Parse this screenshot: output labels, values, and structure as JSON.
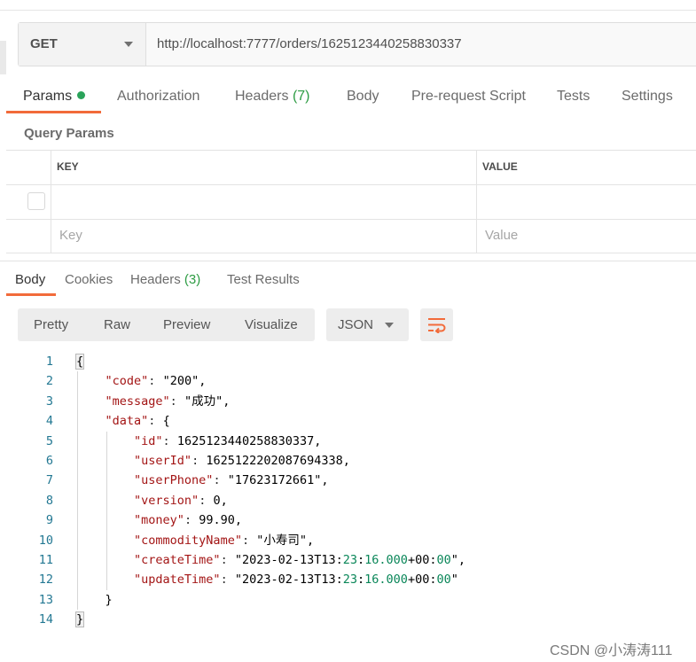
{
  "request": {
    "method": "GET",
    "url": "http://localhost:7777/orders/1625123440258830337"
  },
  "request_tabs": [
    {
      "label": "Params",
      "dot": true
    },
    {
      "label": "Authorization"
    },
    {
      "label": "Headers",
      "count": "(7)"
    },
    {
      "label": "Body"
    },
    {
      "label": "Pre-request Script"
    },
    {
      "label": "Tests"
    },
    {
      "label": "Settings"
    }
  ],
  "query_params": {
    "title": "Query Params",
    "headers": {
      "key": "KEY",
      "value": "VALUE"
    },
    "placeholders": {
      "key": "Key",
      "value": "Value"
    }
  },
  "response_tabs": [
    {
      "label": "Body"
    },
    {
      "label": "Cookies"
    },
    {
      "label": "Headers",
      "count": "(3)"
    },
    {
      "label": "Test Results"
    }
  ],
  "view_modes": [
    "Pretty",
    "Raw",
    "Preview",
    "Visualize"
  ],
  "format": "JSON",
  "response_lines": [
    {
      "n": "1",
      "t": "{"
    },
    {
      "n": "2",
      "t": "    \"code\": \"200\","
    },
    {
      "n": "3",
      "t": "    \"message\": \"成功\","
    },
    {
      "n": "4",
      "t": "    \"data\": {"
    },
    {
      "n": "5",
      "t": "        \"id\": 1625123440258830337,"
    },
    {
      "n": "6",
      "t": "        \"userId\": 1625122202087694338,"
    },
    {
      "n": "7",
      "t": "        \"userPhone\": \"17623172661\","
    },
    {
      "n": "8",
      "t": "        \"version\": 0,"
    },
    {
      "n": "9",
      "t": "        \"money\": 99.90,"
    },
    {
      "n": "10",
      "t": "        \"commodityName\": \"小寿司\","
    },
    {
      "n": "11",
      "t": "        \"createTime\": \"2023-02-13T13:23:16.000+00:00\","
    },
    {
      "n": "12",
      "t": "        \"updateTime\": \"2023-02-13T13:23:16.000+00:00\""
    },
    {
      "n": "13",
      "t": "    }"
    },
    {
      "n": "14",
      "t": "}"
    }
  ],
  "watermark": "CSDN @小涛涛111",
  "colors": {
    "accent": "#f26b3a",
    "count_green": "#2e9c44",
    "dot_green": "#2aa35a"
  }
}
